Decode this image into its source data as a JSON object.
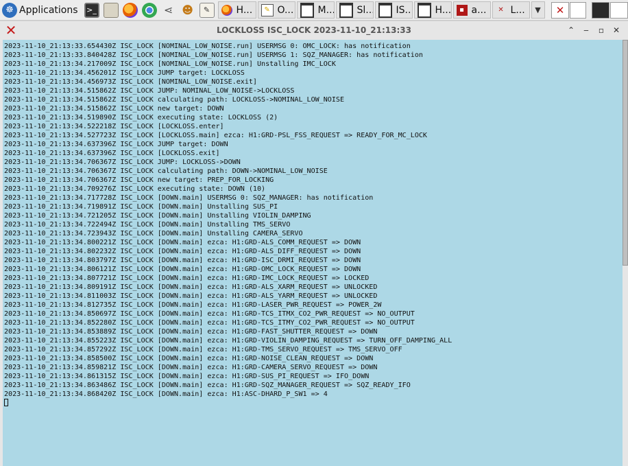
{
  "panel": {
    "applications_label": "Applications",
    "launchers": [
      {
        "icon": "terminal-icon"
      },
      {
        "icon": "file-manager-icon"
      },
      {
        "icon": "firefox-icon"
      },
      {
        "icon": "chromium-icon"
      },
      {
        "icon": "share-icon"
      },
      {
        "icon": "people-icon"
      },
      {
        "icon": "text-editor-icon"
      }
    ],
    "tasks": [
      {
        "label": "H...",
        "icon": "firefox-icon"
      },
      {
        "label": "O...",
        "icon": "document-icon"
      },
      {
        "label": "M...",
        "icon": "window-icon"
      },
      {
        "label": "Sl...",
        "icon": "window-icon"
      },
      {
        "label": "IS...",
        "icon": "window-icon"
      },
      {
        "label": "H...",
        "icon": "window-icon"
      },
      {
        "label": "a...",
        "icon": "red-app-icon"
      },
      {
        "label": "L...",
        "icon": "guardian-x-icon"
      }
    ]
  },
  "window": {
    "title": "LOCKLOSS ISC_LOCK 2023-11-10_21:13:33",
    "lines": [
      "2023-11-10_21:13:33.654430Z ISC_LOCK [NOMINAL_LOW_NOISE.run] USERMSG 0: OMC_LOCK: has notification",
      "2023-11-10_21:13:33.840428Z ISC_LOCK [NOMINAL_LOW_NOISE.run] USERMSG 1: SQZ_MANAGER: has notification",
      "2023-11-10_21:13:34.217009Z ISC_LOCK [NOMINAL_LOW_NOISE.run] Unstalling IMC_LOCK",
      "2023-11-10_21:13:34.456201Z ISC_LOCK JUMP target: LOCKLOSS",
      "2023-11-10_21:13:34.456973Z ISC_LOCK [NOMINAL_LOW_NOISE.exit]",
      "2023-11-10_21:13:34.515862Z ISC_LOCK JUMP: NOMINAL_LOW_NOISE->LOCKLOSS",
      "2023-11-10_21:13:34.515862Z ISC_LOCK calculating path: LOCKLOSS->NOMINAL_LOW_NOISE",
      "2023-11-10_21:13:34.515862Z ISC_LOCK new target: DOWN",
      "2023-11-10_21:13:34.519890Z ISC_LOCK executing state: LOCKLOSS (2)",
      "2023-11-10_21:13:34.522218Z ISC_LOCK [LOCKLOSS.enter]",
      "2023-11-10_21:13:34.527723Z ISC_LOCK [LOCKLOSS.main] ezca: H1:GRD-PSL_FSS_REQUEST => READY_FOR_MC_LOCK",
      "2023-11-10_21:13:34.637396Z ISC_LOCK JUMP target: DOWN",
      "2023-11-10_21:13:34.637396Z ISC_LOCK [LOCKLOSS.exit]",
      "2023-11-10_21:13:34.706367Z ISC_LOCK JUMP: LOCKLOSS->DOWN",
      "2023-11-10_21:13:34.706367Z ISC_LOCK calculating path: DOWN->NOMINAL_LOW_NOISE",
      "2023-11-10_21:13:34.706367Z ISC_LOCK new target: PREP_FOR_LOCKING",
      "2023-11-10_21:13:34.709276Z ISC_LOCK executing state: DOWN (10)",
      "2023-11-10_21:13:34.717728Z ISC_LOCK [DOWN.main] USERMSG 0: SQZ_MANAGER: has notification",
      "2023-11-10_21:13:34.719891Z ISC_LOCK [DOWN.main] Unstalling SUS_PI",
      "2023-11-10_21:13:34.721205Z ISC_LOCK [DOWN.main] Unstalling VIOLIN_DAMPING",
      "2023-11-10_21:13:34.722494Z ISC_LOCK [DOWN.main] Unstalling TMS_SERVO",
      "2023-11-10_21:13:34.723943Z ISC_LOCK [DOWN.main] Unstalling CAMERA_SERVO",
      "2023-11-10_21:13:34.800221Z ISC_LOCK [DOWN.main] ezca: H1:GRD-ALS_COMM_REQUEST => DOWN",
      "2023-11-10_21:13:34.802232Z ISC_LOCK [DOWN.main] ezca: H1:GRD-ALS_DIFF_REQUEST => DOWN",
      "2023-11-10_21:13:34.803797Z ISC_LOCK [DOWN.main] ezca: H1:GRD-ISC_DRMI_REQUEST => DOWN",
      "2023-11-10_21:13:34.806121Z ISC_LOCK [DOWN.main] ezca: H1:GRD-OMC_LOCK_REQUEST => DOWN",
      "2023-11-10_21:13:34.807721Z ISC_LOCK [DOWN.main] ezca: H1:GRD-IMC_LOCK_REQUEST => LOCKED",
      "2023-11-10_21:13:34.809191Z ISC_LOCK [DOWN.main] ezca: H1:GRD-ALS_XARM_REQUEST => UNLOCKED",
      "2023-11-10_21:13:34.811003Z ISC_LOCK [DOWN.main] ezca: H1:GRD-ALS_YARM_REQUEST => UNLOCKED",
      "2023-11-10_21:13:34.812735Z ISC_LOCK [DOWN.main] ezca: H1:GRD-LASER_PWR_REQUEST => POWER_2W",
      "2023-11-10_21:13:34.850697Z ISC_LOCK [DOWN.main] ezca: H1:GRD-TCS_ITMX_CO2_PWR_REQUEST => NO_OUTPUT",
      "2023-11-10_21:13:34.852280Z ISC_LOCK [DOWN.main] ezca: H1:GRD-TCS_ITMY_CO2_PWR_REQUEST => NO_OUTPUT",
      "2023-11-10_21:13:34.853889Z ISC_LOCK [DOWN.main] ezca: H1:GRD-FAST_SHUTTER_REQUEST => DOWN",
      "2023-11-10_21:13:34.855223Z ISC_LOCK [DOWN.main] ezca: H1:GRD-VIOLIN_DAMPING_REQUEST => TURN_OFF_DAMPING_ALL",
      "2023-11-10_21:13:34.857292Z ISC_LOCK [DOWN.main] ezca: H1:GRD-TMS_SERVO_REQUEST => TMS_SERVO_OFF",
      "2023-11-10_21:13:34.858500Z ISC_LOCK [DOWN.main] ezca: H1:GRD-NOISE_CLEAN_REQUEST => DOWN",
      "2023-11-10_21:13:34.859821Z ISC_LOCK [DOWN.main] ezca: H1:GRD-CAMERA_SERVO_REQUEST => DOWN",
      "2023-11-10_21:13:34.861315Z ISC_LOCK [DOWN.main] ezca: H1:GRD-SUS_PI_REQUEST => IFO_DOWN",
      "2023-11-10_21:13:34.863486Z ISC_LOCK [DOWN.main] ezca: H1:GRD-SQZ_MANAGER_REQUEST => SQZ_READY_IFO",
      "2023-11-10_21:13:34.868420Z ISC_LOCK [DOWN.main] ezca: H1:ASC-DHARD_P_SW1 => 4"
    ]
  },
  "colors": {
    "log_background": "#add8e6",
    "title_text": "#555555",
    "guardian_x": "#c51a1a"
  }
}
